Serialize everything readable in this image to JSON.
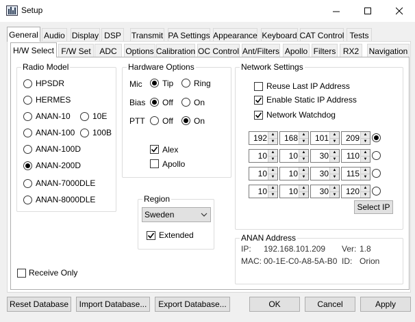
{
  "window": {
    "title": "Setup"
  },
  "main_tabs": [
    "General",
    "Audio",
    "Display",
    "DSP",
    "Transmit",
    "PA Settings",
    "Appearance",
    "Keyboard",
    "CAT Control",
    "Tests"
  ],
  "sub_tabs": [
    "H/W Select",
    "F/W Set",
    "ADC",
    "Options",
    "Calibration",
    "OC Control",
    "Ant/Filters",
    "Apollo",
    "Filters",
    "RX2",
    "Navigation"
  ],
  "radio_model": {
    "title": "Radio Model",
    "options": [
      "HPSDR",
      "HERMES",
      "ANAN-10",
      "10E",
      "ANAN-100",
      "100B",
      "ANAN-100D",
      "ANAN-200D",
      "ANAN-7000DLE",
      "ANAN-8000DLE"
    ],
    "selected": "ANAN-200D"
  },
  "hardware_options": {
    "title": "Hardware Options",
    "mic": {
      "label": "Mic",
      "opt1": "Tip",
      "opt2": "Ring",
      "selected": "Tip"
    },
    "bias": {
      "label": "Bias",
      "opt1": "Off",
      "opt2": "On",
      "selected": "Off"
    },
    "ptt": {
      "label": "PTT",
      "opt1": "Off",
      "opt2": "On",
      "selected": "On"
    },
    "alex": {
      "label": "Alex",
      "checked": true
    },
    "apollo": {
      "label": "Apollo",
      "checked": false
    }
  },
  "region": {
    "title": "Region",
    "value": "Sweden",
    "extended_label": "Extended",
    "extended_checked": true
  },
  "receive_only": {
    "label": "Receive Only",
    "checked": false
  },
  "network": {
    "title": "Network Settings",
    "reuse_ip": {
      "label": "Reuse Last IP Address",
      "checked": false
    },
    "static_ip": {
      "label": "Enable Static IP Address",
      "checked": true
    },
    "watchdog": {
      "label": "Network Watchdog",
      "checked": true
    },
    "ip_rows": [
      {
        "octets": [
          "192",
          "168",
          "101",
          "209"
        ],
        "selected": true
      },
      {
        "octets": [
          "10",
          "10",
          "30",
          "110"
        ],
        "selected": false
      },
      {
        "octets": [
          "10",
          "10",
          "30",
          "115"
        ],
        "selected": false
      },
      {
        "octets": [
          "10",
          "10",
          "30",
          "120"
        ],
        "selected": false
      }
    ],
    "select_ip_label": "Select IP"
  },
  "anan_address": {
    "title": "ANAN Address",
    "ip_label": "IP:",
    "ip_value": "192.168.101.209",
    "ver_label": "Ver:",
    "ver_value": "1.8",
    "mac_label": "MAC:",
    "mac_value": "00-1E-C0-A8-5A-B0",
    "id_label": "ID:",
    "id_value": "Orion"
  },
  "buttons": {
    "reset_db": "Reset Database",
    "import_db": "Import Database...",
    "export_db": "Export Database...",
    "ok": "OK",
    "cancel": "Cancel",
    "apply": "Apply"
  }
}
